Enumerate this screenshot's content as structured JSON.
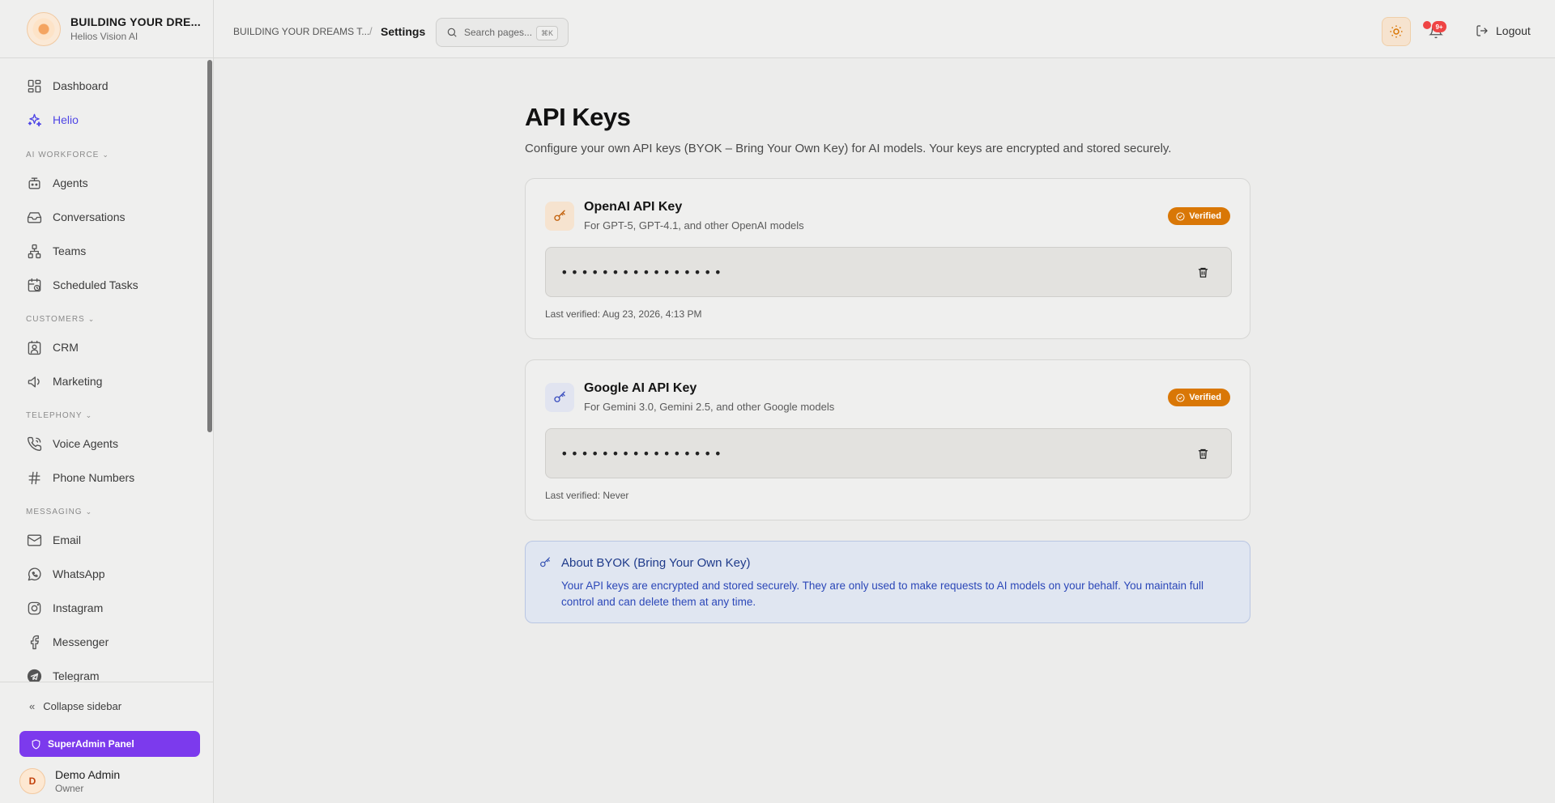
{
  "brand": {
    "title": "BUILDING YOUR DRE...",
    "subtitle": "Helios Vision AI"
  },
  "sidebar": {
    "items": [
      {
        "label": "Dashboard",
        "icon": "dashboard-icon"
      },
      {
        "label": "Helio",
        "icon": "sparkles-icon",
        "active": true
      }
    ],
    "sections": [
      {
        "label": "AI WORKFORCE",
        "items": [
          {
            "label": "Agents",
            "icon": "bot-icon"
          },
          {
            "label": "Conversations",
            "icon": "inbox-icon"
          },
          {
            "label": "Teams",
            "icon": "network-icon"
          },
          {
            "label": "Scheduled Tasks",
            "icon": "calendar-clock-icon"
          }
        ]
      },
      {
        "label": "CUSTOMERS",
        "items": [
          {
            "label": "CRM",
            "icon": "contact-icon"
          },
          {
            "label": "Marketing",
            "icon": "megaphone-icon"
          }
        ]
      },
      {
        "label": "TELEPHONY",
        "items": [
          {
            "label": "Voice Agents",
            "icon": "phone-call-icon"
          },
          {
            "label": "Phone Numbers",
            "icon": "hash-icon"
          }
        ]
      },
      {
        "label": "MESSAGING",
        "items": [
          {
            "label": "Email",
            "icon": "mail-icon"
          },
          {
            "label": "WhatsApp",
            "icon": "whatsapp-icon"
          },
          {
            "label": "Instagram",
            "icon": "instagram-icon"
          },
          {
            "label": "Messenger",
            "icon": "facebook-icon"
          },
          {
            "label": "Telegram",
            "icon": "telegram-icon"
          }
        ]
      }
    ],
    "collapse_label": "Collapse sidebar",
    "superadmin_label": "SuperAdmin Panel",
    "user": {
      "initial": "D",
      "name": "Demo Admin",
      "role": "Owner"
    }
  },
  "header": {
    "breadcrumb_parent": "BUILDING YOUR DREAMS T...",
    "breadcrumb_separator": "/",
    "breadcrumb_current": "Settings",
    "search_placeholder": "Search pages...",
    "search_shortcut": "⌘K",
    "notification_count": "9+",
    "logout_label": "Logout"
  },
  "main": {
    "title": "API Keys",
    "description": "Configure your own API keys (BYOK – Bring Your Own Key) for AI models. Your keys are encrypted and stored securely.",
    "keys": [
      {
        "title": "OpenAI API Key",
        "subtitle": "For GPT-5, GPT-4.1, and other OpenAI models",
        "status": "Verified",
        "masked_value": "••••••••••••••••",
        "last_verified": "Last verified: Aug 23, 2026, 4:13 PM"
      },
      {
        "title": "Google AI API Key",
        "subtitle": "For Gemini 3.0, Gemini 2.5, and other Google models",
        "status": "Verified",
        "masked_value": "••••••••••••••••",
        "last_verified": "Last verified: Never"
      }
    ],
    "info": {
      "title": "About BYOK (Bring Your Own Key)",
      "body": "Your API keys are encrypted and stored securely. They are only used to make requests to AI models on your behalf. You maintain full control and can delete them at any time."
    }
  },
  "colors": {
    "accent": "#4f46e5",
    "verified": "#d97706",
    "superadmin": "#7c3aed",
    "info": "#2b47b8"
  }
}
